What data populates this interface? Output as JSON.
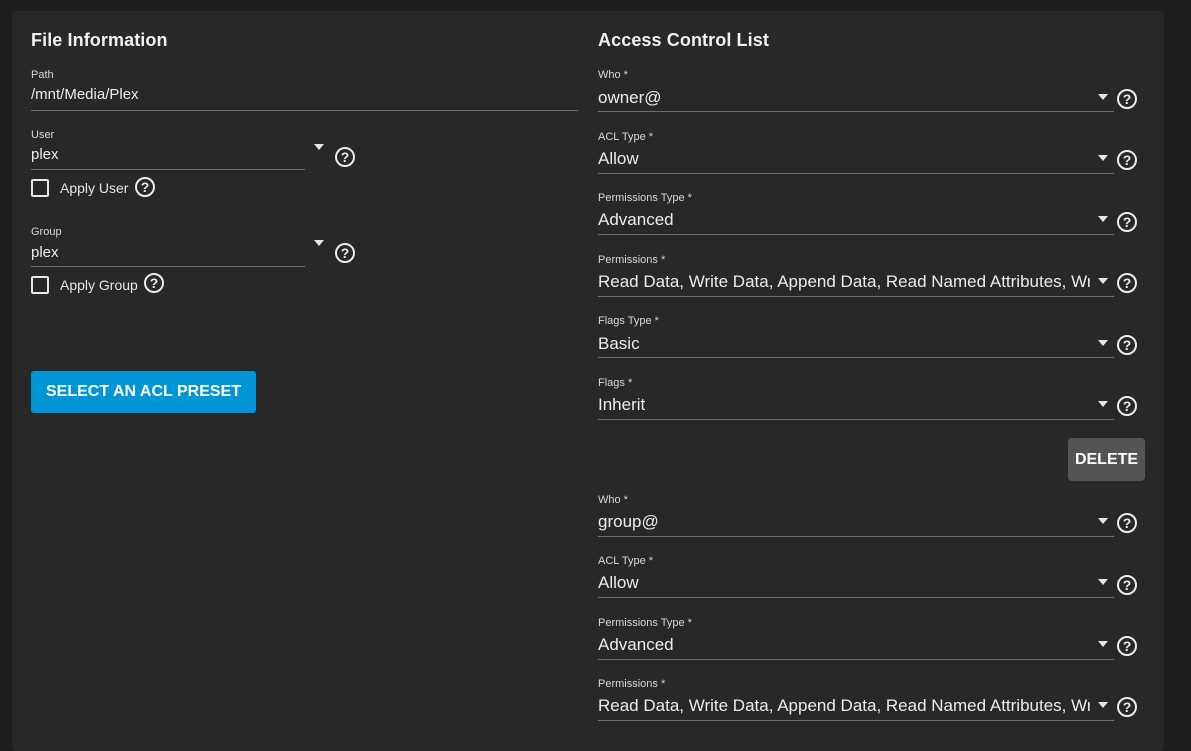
{
  "file_info": {
    "title": "File Information",
    "path": {
      "label": "Path",
      "value": "/mnt/Media/Plex"
    },
    "user": {
      "label": "User",
      "value": "plex",
      "apply_label": "Apply User",
      "apply_checked": false
    },
    "group": {
      "label": "Group",
      "value": "plex",
      "apply_label": "Apply Group",
      "apply_checked": false
    },
    "preset_button": "SELECT AN ACL PRESET"
  },
  "acl": {
    "title": "Access Control List",
    "delete_label": "DELETE",
    "entries": [
      {
        "fields": [
          {
            "label": "Who *",
            "value": "owner@"
          },
          {
            "label": "ACL Type *",
            "value": "Allow"
          },
          {
            "label": "Permissions Type *",
            "value": "Advanced"
          },
          {
            "label": "Permissions *",
            "value": "Read Data, Write Data, Append Data, Read Named Attributes, Wri…"
          },
          {
            "label": "Flags Type *",
            "value": "Basic"
          },
          {
            "label": "Flags *",
            "value": "Inherit"
          }
        ]
      },
      {
        "fields": [
          {
            "label": "Who *",
            "value": "group@"
          },
          {
            "label": "ACL Type *",
            "value": "Allow"
          },
          {
            "label": "Permissions Type *",
            "value": "Advanced"
          },
          {
            "label": "Permissions *",
            "value": "Read Data, Write Data, Append Data, Read Named Attributes, Wri…"
          }
        ]
      }
    ]
  },
  "icons": {
    "help": "help-circle-icon",
    "dropdown": "caret-down-icon",
    "checkbox": "checkbox-unchecked-icon"
  },
  "colors": {
    "background": "#1e1e1e",
    "card": "#282828",
    "primary_button": "#0095d5",
    "delete_button": "#545454",
    "underline": "#6e6e6e"
  }
}
